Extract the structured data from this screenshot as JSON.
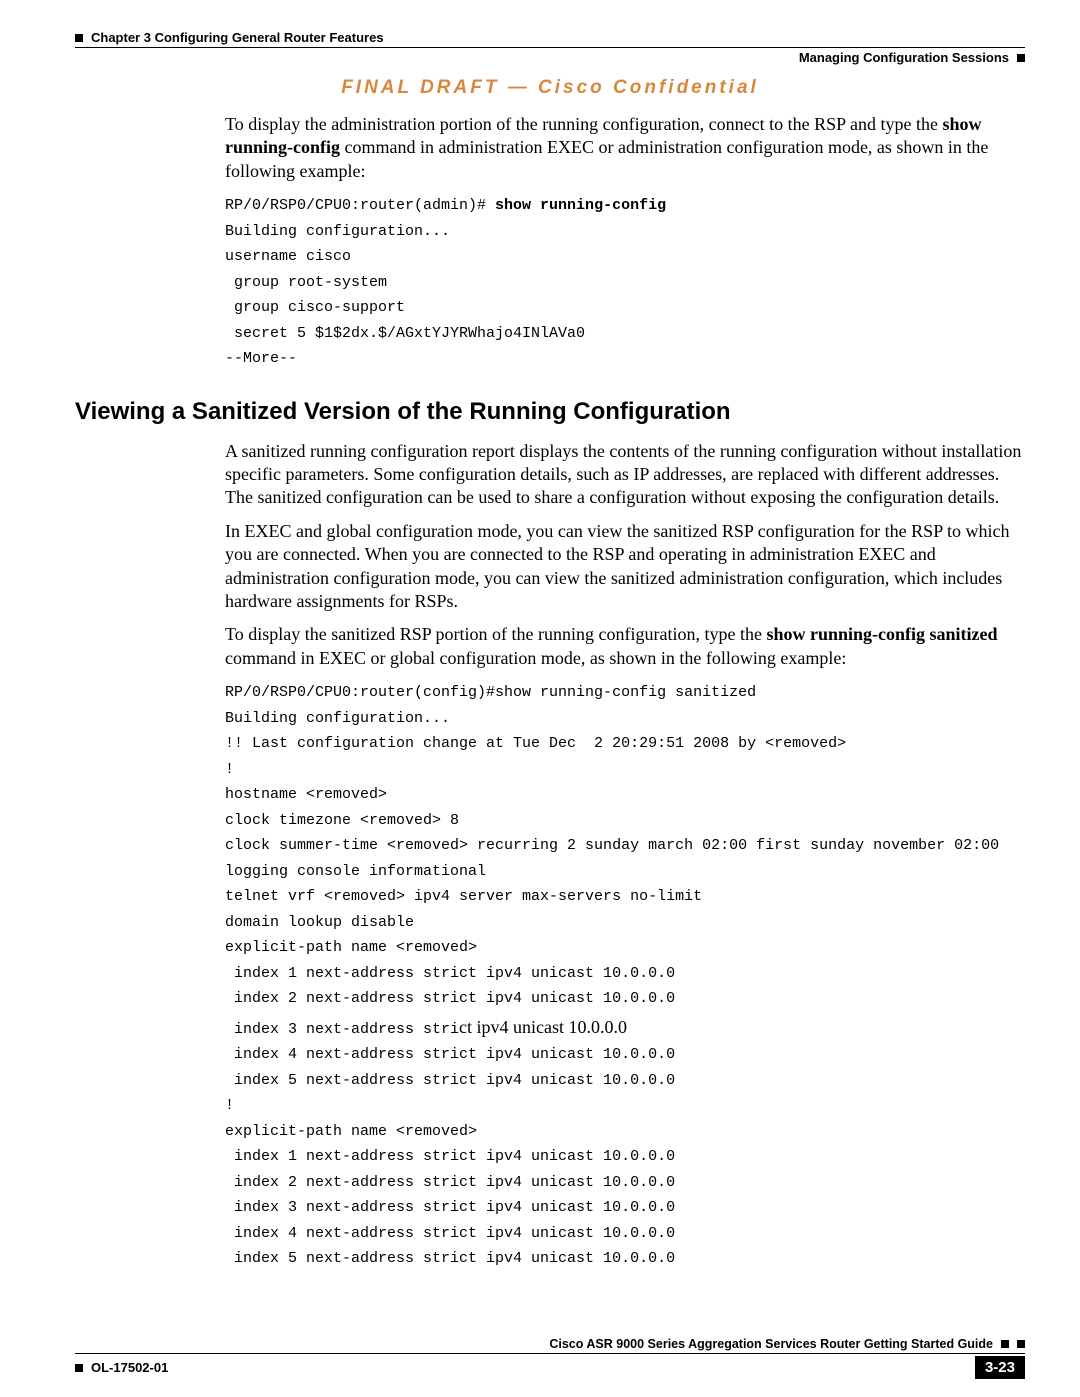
{
  "header": {
    "chapter": "Chapter 3    Configuring General Router Features",
    "section": "Managing Configuration Sessions"
  },
  "watermark": "FINAL DRAFT — Cisco Confidential",
  "intro": {
    "p1_a": "To display the administration portion of the running configuration, connect to the RSP and type the ",
    "p1_b": "show running-config",
    "p1_c": " command in administration EXEC or administration configuration mode, as shown in the following example:"
  },
  "code1": {
    "prompt": "RP/0/RSP0/CPU0:router(admin)# ",
    "cmd": "show running-config",
    "body": "Building configuration...\nusername cisco\n group root-system\n group cisco-support\n secret 5 $1$2dx.$/AGxtYJYRWhajo4INlAVa0\n--More--"
  },
  "h2": "Viewing a Sanitized Version of the Running Configuration",
  "san": {
    "p1": "A sanitized running configuration report displays the contents of the running configuration without installation specific parameters. Some configuration details, such as IP addresses, are replaced with different addresses. The sanitized configuration can be used to share a configuration without exposing the configuration details.",
    "p2": "In EXEC and global configuration mode, you can view the sanitized RSP configuration for the RSP to which you are connected. When you are connected to the RSP and operating in administration EXEC and administration configuration mode, you can view the sanitized administration configuration, which includes hardware assignments for RSPs.",
    "p3_a": "To display the sanitized RSP portion of the running configuration, type the ",
    "p3_b": "show running-config sanitized",
    "p3_c": " command in EXEC or global configuration mode, as shown in the following example:"
  },
  "code2_a": "RP/0/RSP0/CPU0:router(config)#show running-config sanitized\nBuilding configuration...\n!! Last configuration change at Tue Dec  2 20:29:51 2008 by <removed>\n!\nhostname <removed>\nclock timezone <removed> 8\nclock summer-time <removed> recurring 2 sunday march 02:00 first sunday november 02:00\nlogging console informational\ntelnet vrf <removed> ipv4 server max-servers no-limit\ndomain lookup disable\nexplicit-path name <removed>\n index 1 next-address strict ipv4 unicast 10.0.0.0\n index 2 next-address strict ipv4 unicast 10.0.0.0\n index 3 next-address stri",
  "code2_odd": "ct ipv4 unicast 10.0.0.0",
  "code2_b": " index 4 next-address strict ipv4 unicast 10.0.0.0\n index 5 next-address strict ipv4 unicast 10.0.0.0\n!\nexplicit-path name <removed>\n index 1 next-address strict ipv4 unicast 10.0.0.0\n index 2 next-address strict ipv4 unicast 10.0.0.0\n index 3 next-address strict ipv4 unicast 10.0.0.0\n index 4 next-address strict ipv4 unicast 10.0.0.0\n index 5 next-address strict ipv4 unicast 10.0.0.0",
  "footer": {
    "title": "Cisco ASR 9000 Series Aggregation Services Router Getting Started Guide",
    "doc": "OL-17502-01",
    "page": "3-23"
  }
}
